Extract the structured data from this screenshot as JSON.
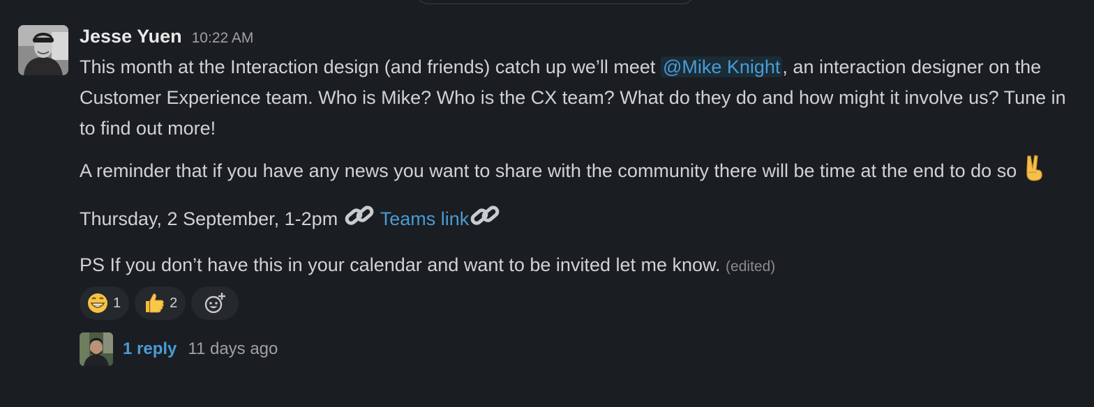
{
  "message": {
    "author": "Jesse Yuen",
    "timestamp": "10:22 AM",
    "paragraph1": {
      "before_mention": "This month at the Interaction design (and friends) catch up we’ll meet ",
      "mention": "@Mike Knight",
      "after_mention": ", an interaction designer on the Customer Experience team. Who is Mike? Who is the CX team? What do they do and how might it involve us? Tune in to find out more!"
    },
    "paragraph2": {
      "text": "A reminder that if you have any news you want to share with the community there will be time at the end to do so ",
      "emoji": "victory-hand"
    },
    "paragraph3": {
      "date_text": "Thursday, 2 September, 1-2pm ",
      "link_text": "Teams link",
      "emoji_before": "link",
      "emoji_after": "link"
    },
    "paragraph4": {
      "text": "PS If you don’t have this in your calendar and want to be invited let me know. ",
      "edited_label": "(edited)"
    }
  },
  "reactions": [
    {
      "emoji": "grinning-face",
      "count": "1"
    },
    {
      "emoji": "thumbs-up",
      "count": "2"
    }
  ],
  "add_reaction_icon": "add-reaction-icon",
  "thread": {
    "reply_count": "1 reply",
    "last_reply": "11 days ago"
  },
  "colors": {
    "background": "#1a1d21",
    "link": "#4a9bd6",
    "reaction_bg": "#25282c"
  }
}
